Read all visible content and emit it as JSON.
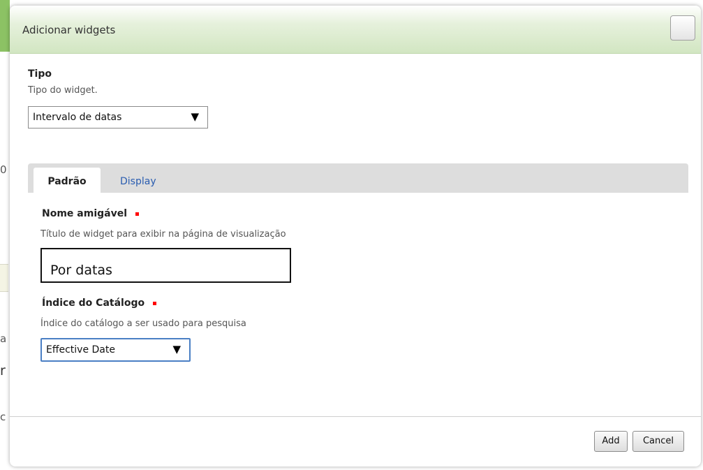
{
  "background": {
    "fragments": [
      "0",
      "a",
      "r",
      "c"
    ]
  },
  "dialog": {
    "title": "Adicionar widgets",
    "type_field": {
      "label": "Tipo",
      "description": "Tipo do widget.",
      "selected": "Intervalo de datas"
    },
    "tabs": [
      {
        "label": "Padrão",
        "active": true
      },
      {
        "label": "Display",
        "active": false
      }
    ],
    "friendly_name": {
      "label": "Nome amigável",
      "description": "Título de widget para exibir na página de visualização",
      "value": "Por datas",
      "required": true
    },
    "catalog_index": {
      "label": "Índice do Catálogo",
      "description": "Índice do catálogo a ser usado para pesquisa",
      "selected": "Effective Date",
      "required": true
    },
    "buttons": {
      "add": "Add",
      "cancel": "Cancel"
    }
  },
  "colors": {
    "title_bar": "#d2e6c2",
    "tab_link": "#2a5db0",
    "required_marker": "#ff0000"
  }
}
